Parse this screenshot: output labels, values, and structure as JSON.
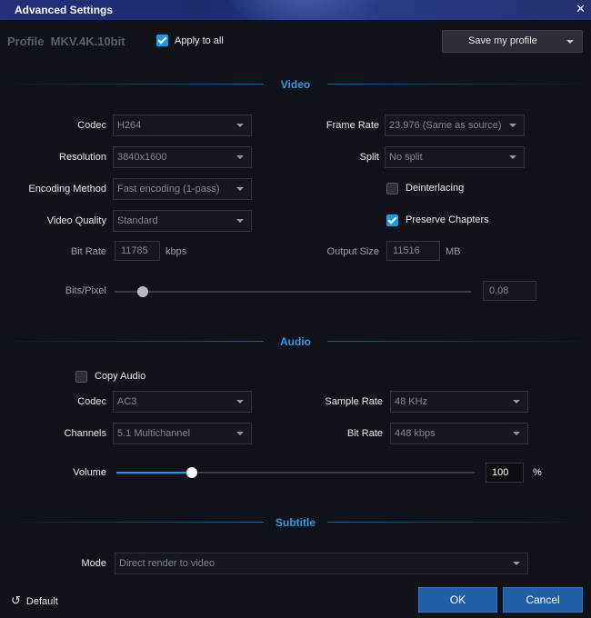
{
  "window": {
    "title": "Advanced Settings",
    "close_glyph": "✕"
  },
  "profile": {
    "label": "Profile  MKV.4K.10bit",
    "apply_to_all": {
      "label": "Apply to all",
      "checked": true
    },
    "save_button": "Save my profile"
  },
  "video": {
    "section_title": "Video",
    "codec": {
      "label": "Codec",
      "value": "H264"
    },
    "resolution": {
      "label": "Resolution",
      "value": "3840x1600"
    },
    "encoding_method": {
      "label": "Encoding Method",
      "value": "Fast encoding (1-pass)"
    },
    "video_quality": {
      "label": "Video Quality",
      "value": "Standard"
    },
    "bit_rate": {
      "label": "Bit Rate",
      "value": "11785",
      "unit": "kbps"
    },
    "frame_rate": {
      "label": "Frame Rate",
      "value": "23.976 (Same as source)"
    },
    "split": {
      "label": "Split",
      "value": "No split"
    },
    "deinterlacing": {
      "label": "Deinterlacing",
      "checked": false
    },
    "preserve_chapters": {
      "label": "Preserve Chapters",
      "checked": true
    },
    "output_size": {
      "label": "Output Size",
      "value": "11516",
      "unit": "MB"
    },
    "bits_per_pixel": {
      "label": "Bits/Pixel",
      "value": "0.08",
      "slider_fraction": 0.08
    }
  },
  "audio": {
    "section_title": "Audio",
    "copy_audio": {
      "label": "Copy Audio",
      "checked": false
    },
    "codec": {
      "label": "Codec",
      "value": "AC3"
    },
    "channels": {
      "label": "Channels",
      "value": "5.1 Multichannel"
    },
    "sample_rate": {
      "label": "Sample Rate",
      "value": "48 KHz"
    },
    "bit_rate": {
      "label": "Bit Rate",
      "value": "448 kbps"
    },
    "volume": {
      "label": "Volume",
      "value": "100",
      "unit": "%",
      "slider_fraction": 0.21
    }
  },
  "subtitle": {
    "section_title": "Subtitle",
    "mode": {
      "label": "Mode",
      "value": "Direct render to video"
    }
  },
  "footer": {
    "default_label": "Default",
    "default_icon": "↺",
    "ok_label": "OK",
    "cancel_label": "Cancel"
  },
  "colors": {
    "accent": "#1e9be0",
    "section_title": "#2f9be6",
    "titlebar": "#22306f",
    "background": "#11131b",
    "primary_button": "#1f5fa8"
  }
}
